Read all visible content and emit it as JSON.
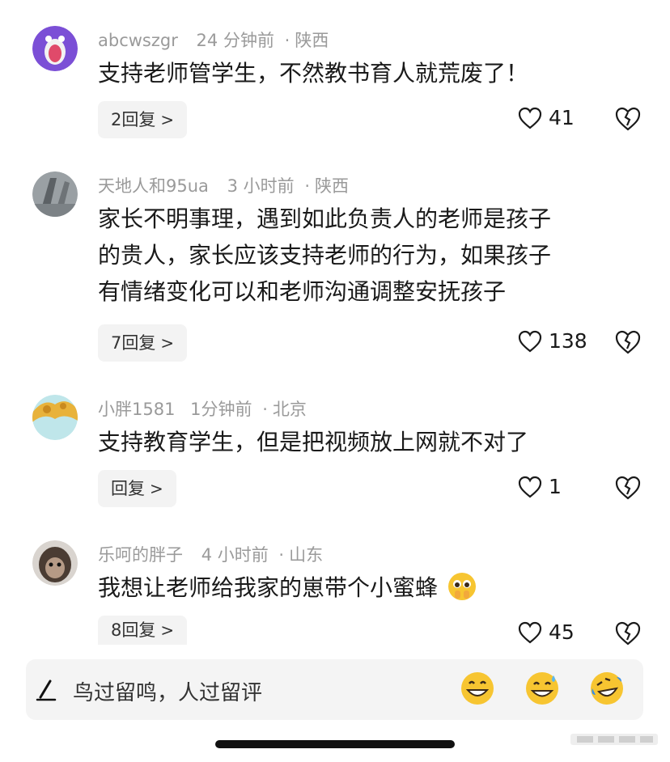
{
  "comments": [
    {
      "user": "abcwszgr",
      "time": "24 分钟前",
      "location": "陕西",
      "lines": [
        "支持老师管学生，不然教书育人就荒废了！"
      ],
      "reply_label": "2回复",
      "likes": "41",
      "avatar_color": "#7b4fd6"
    },
    {
      "user": "天地人和95ua",
      "time": "3 小时前",
      "location": "陕西",
      "lines": [
        "家长不明事理，遇到如此负责人的老师是孩子",
        "的贵人，家长应该支持老师的行为，如果孩子",
        "有情绪变化可以和老师沟通调整安抚孩子"
      ],
      "reply_label": "7回复",
      "likes": "138",
      "avatar_color": "#8a8f94"
    },
    {
      "user": "小胖1581",
      "time": "1分钟前",
      "location": "北京",
      "lines": [
        "支持教育学生，但是把视频放上网就不对了"
      ],
      "reply_label": "回复",
      "likes": "1",
      "avatar_color": "#e8b23a"
    },
    {
      "user": "乐呵的胖子",
      "time": "4 小时前",
      "location": "山东",
      "lines": [
        "我想让老师给我家的崽带个小蜜蜂"
      ],
      "reply_label": "8回复",
      "likes": "45",
      "avatar_color": "#6b5a4e"
    }
  ],
  "dot": "·",
  "input": {
    "placeholder": "鸟过留鸣，人过留评"
  },
  "icons": {
    "reply_chevron": ">"
  }
}
